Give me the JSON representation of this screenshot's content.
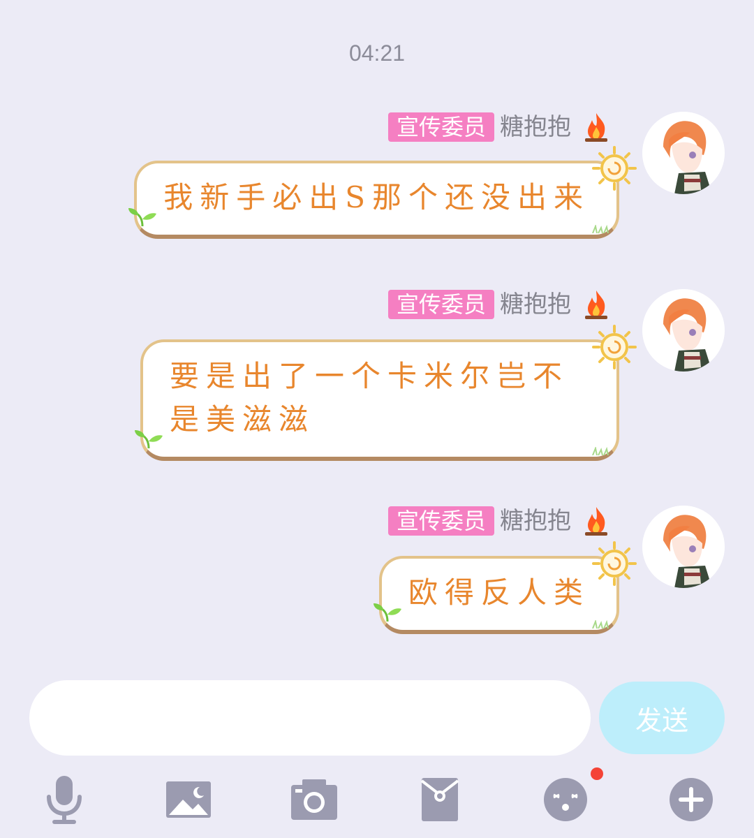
{
  "chat": {
    "timestamp": "04:21",
    "messages": [
      {
        "badge": "宣传委员",
        "nick": "糖抱抱",
        "text": "我新手必出S那个还没出来"
      },
      {
        "badge": "宣传委员",
        "nick": "糖抱抱",
        "text": "要是出了一个卡米尔岂不是美滋滋"
      },
      {
        "badge": "宣传委员",
        "nick": "糖抱抱",
        "text": "欧得反人类"
      }
    ]
  },
  "composer": {
    "input_value": "",
    "input_placeholder": "",
    "send_label": "发送"
  },
  "toolbar": {
    "icons": [
      "microphone-icon",
      "image-icon",
      "camera-icon",
      "red-packet-icon",
      "emoji-icon",
      "plus-icon"
    ]
  },
  "colors": {
    "background": "#ecebf6",
    "badge": "#f57fc2",
    "bubble_text": "#e8862d",
    "send_button": "#bdeefb",
    "icon": "#9b9bb0",
    "notification_dot": "#f44336"
  }
}
